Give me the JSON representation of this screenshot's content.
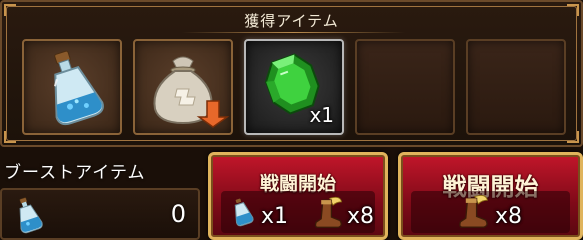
{
  "loot": {
    "title": "獲得アイテム",
    "slots": [
      {
        "icon": "potion-bottle-icon",
        "qty": ""
      },
      {
        "icon": "pouch-bag-icon",
        "qty": ""
      },
      {
        "icon": "green-gem-icon",
        "qty": "x1"
      },
      {
        "icon": "empty-slot",
        "qty": ""
      },
      {
        "icon": "empty-slot",
        "qty": ""
      }
    ]
  },
  "boost": {
    "label": "ブーストアイテム",
    "count": "0",
    "icon": "potion-bottle-icon"
  },
  "battle_buttons": [
    {
      "label": "戦闘開始",
      "costs": [
        {
          "icon": "potion-bottle-icon",
          "qty": "x1"
        },
        {
          "icon": "winged-boot-icon",
          "qty": "x8"
        }
      ]
    },
    {
      "label": "戦闘開始",
      "costs": [
        {
          "icon": "winged-boot-icon",
          "qty": "x8"
        }
      ]
    }
  ],
  "colors": {
    "frame_gold": "#c9954d",
    "button_red": "#c2162a",
    "gem_green": "#2fbf2f"
  }
}
